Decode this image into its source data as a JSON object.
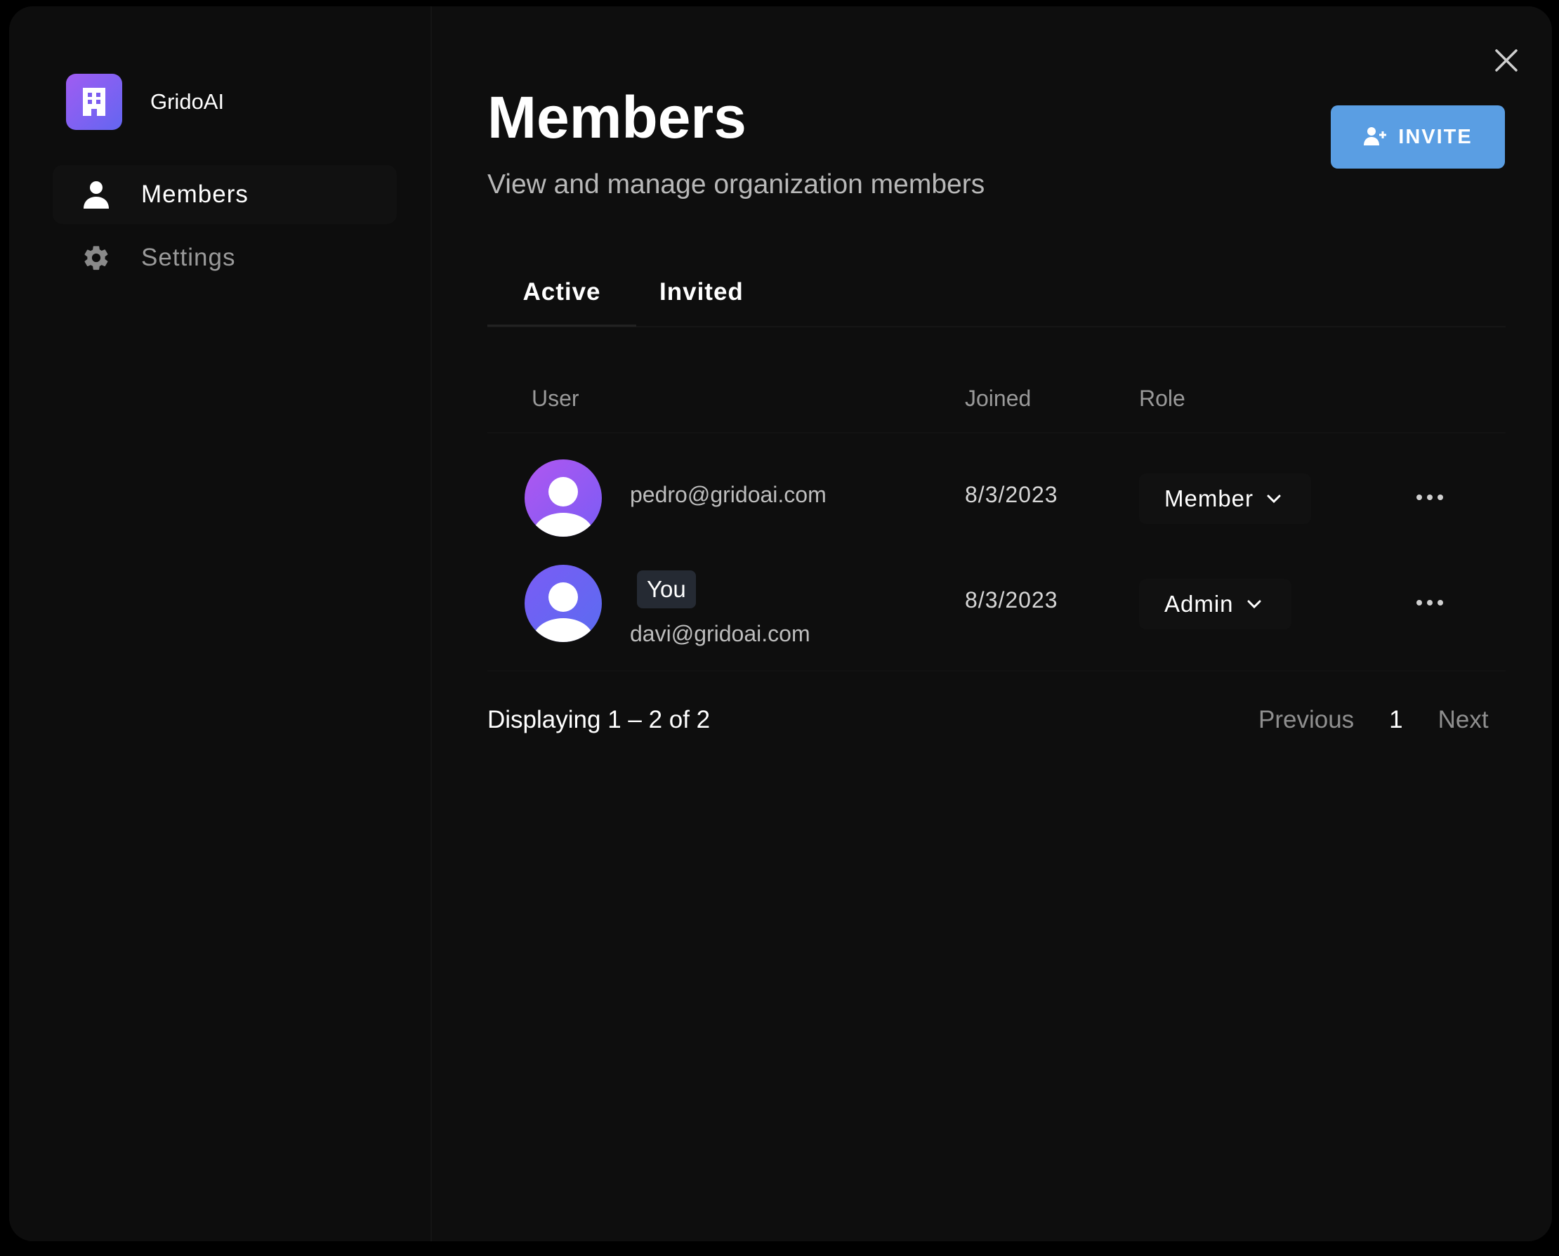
{
  "sidebar": {
    "org_name": "GridoAI",
    "items": [
      {
        "label": "Members",
        "icon": "person-icon",
        "active": true
      },
      {
        "label": "Settings",
        "icon": "gear-icon",
        "active": false
      }
    ]
  },
  "header": {
    "title": "Members",
    "subtitle": "View and manage organization members",
    "invite_label": "INVITE"
  },
  "tabs": [
    {
      "label": "Active",
      "active": true
    },
    {
      "label": "Invited",
      "active": false
    }
  ],
  "table": {
    "columns": [
      "User",
      "Joined",
      "Role"
    ],
    "rows": [
      {
        "email": "pedro@gridoai.com",
        "joined": "8/3/2023",
        "role": "Member",
        "badge": ""
      },
      {
        "email": "davi@gridoai.com",
        "joined": "8/3/2023",
        "role": "Admin",
        "badge": "You"
      }
    ]
  },
  "footer": {
    "count_text": "Displaying 1 – 2 of 2",
    "previous": "Previous",
    "page": "1",
    "next": "Next"
  },
  "colors": {
    "background": "#0e0e0e",
    "accent": "#5a9ee3",
    "avatar_gradient_start": "#a05cf2",
    "avatar_gradient_end": "#6366f1"
  }
}
